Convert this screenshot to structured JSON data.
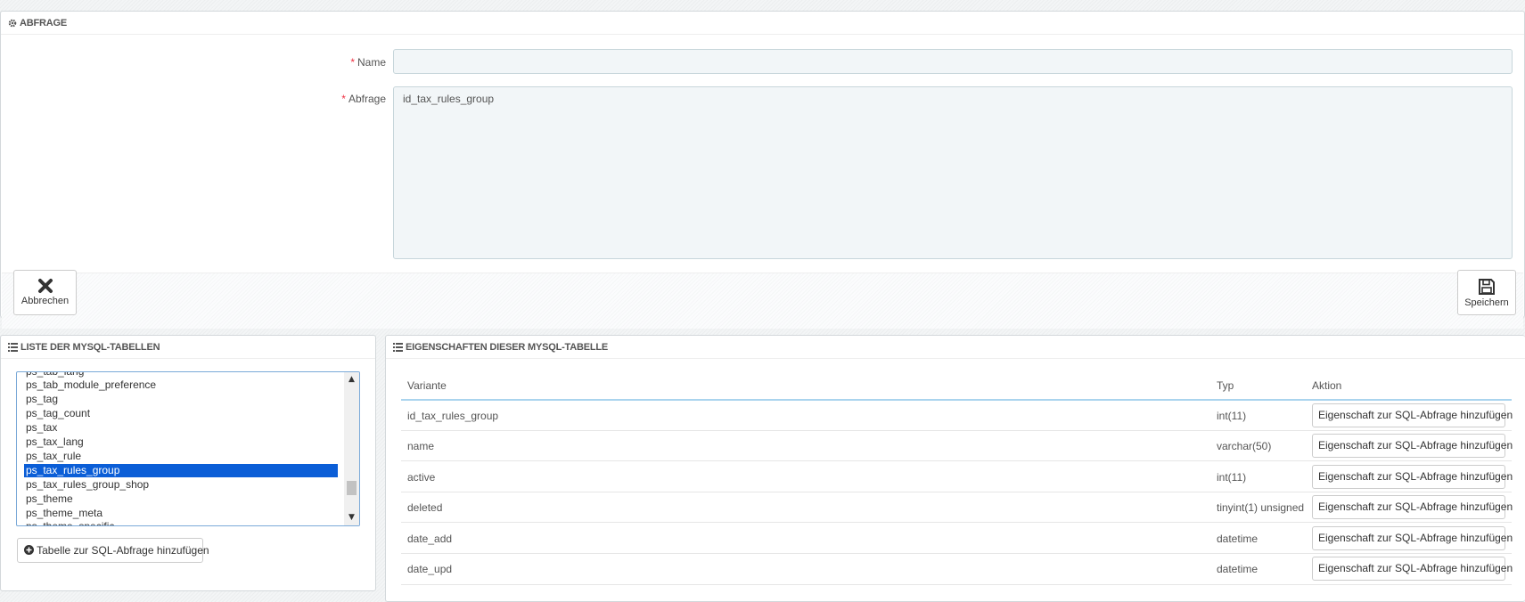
{
  "query_panel": {
    "title": "ABFRAGE",
    "name_label": "Name",
    "name_value": "",
    "query_label": "Abfrage",
    "query_value": "id_tax_rules_group",
    "cancel_label": "Abbrechen",
    "save_label": "Speichern"
  },
  "tables_panel": {
    "title": "LISTE DER MYSQL-TABELLEN",
    "options": [
      "ps_tab_lang",
      "ps_tab_module_preference",
      "ps_tag",
      "ps_tag_count",
      "ps_tax",
      "ps_tax_lang",
      "ps_tax_rule",
      "ps_tax_rules_group",
      "ps_tax_rules_group_shop",
      "ps_theme",
      "ps_theme_meta",
      "ps_theme_specific"
    ],
    "selected": "ps_tax_rules_group",
    "add_button": "Tabelle zur SQL-Abfrage hinzufügen"
  },
  "properties_panel": {
    "title": "EIGENSCHAFTEN DIESER MYSQL-TABELLE",
    "columns": [
      "Variante",
      "Typ",
      "Aktion"
    ],
    "rows": [
      {
        "name": "id_tax_rules_group",
        "type": "int(11)",
        "action": "Eigenschaft zur SQL-Abfrage hinzufügen"
      },
      {
        "name": "name",
        "type": "varchar(50)",
        "action": "Eigenschaft zur SQL-Abfrage hinzufügen"
      },
      {
        "name": "active",
        "type": "int(11)",
        "action": "Eigenschaft zur SQL-Abfrage hinzufügen"
      },
      {
        "name": "deleted",
        "type": "tinyint(1) unsigned",
        "action": "Eigenschaft zur SQL-Abfrage hinzufügen"
      },
      {
        "name": "date_add",
        "type": "datetime",
        "action": "Eigenschaft zur SQL-Abfrage hinzufügen"
      },
      {
        "name": "date_upd",
        "type": "datetime",
        "action": "Eigenschaft zur SQL-Abfrage hinzufügen"
      }
    ]
  },
  "icons": {
    "panel_query": "gear-icon",
    "panel_tables": "list-icon",
    "panel_properties": "list-icon",
    "cancel": "close-icon",
    "save": "floppy-disk-icon",
    "add_table": "plus-circle-icon"
  },
  "colors": {
    "required": "#ee3344",
    "selection": "#0b5ed7",
    "table_header_line": "#aad4ee"
  }
}
